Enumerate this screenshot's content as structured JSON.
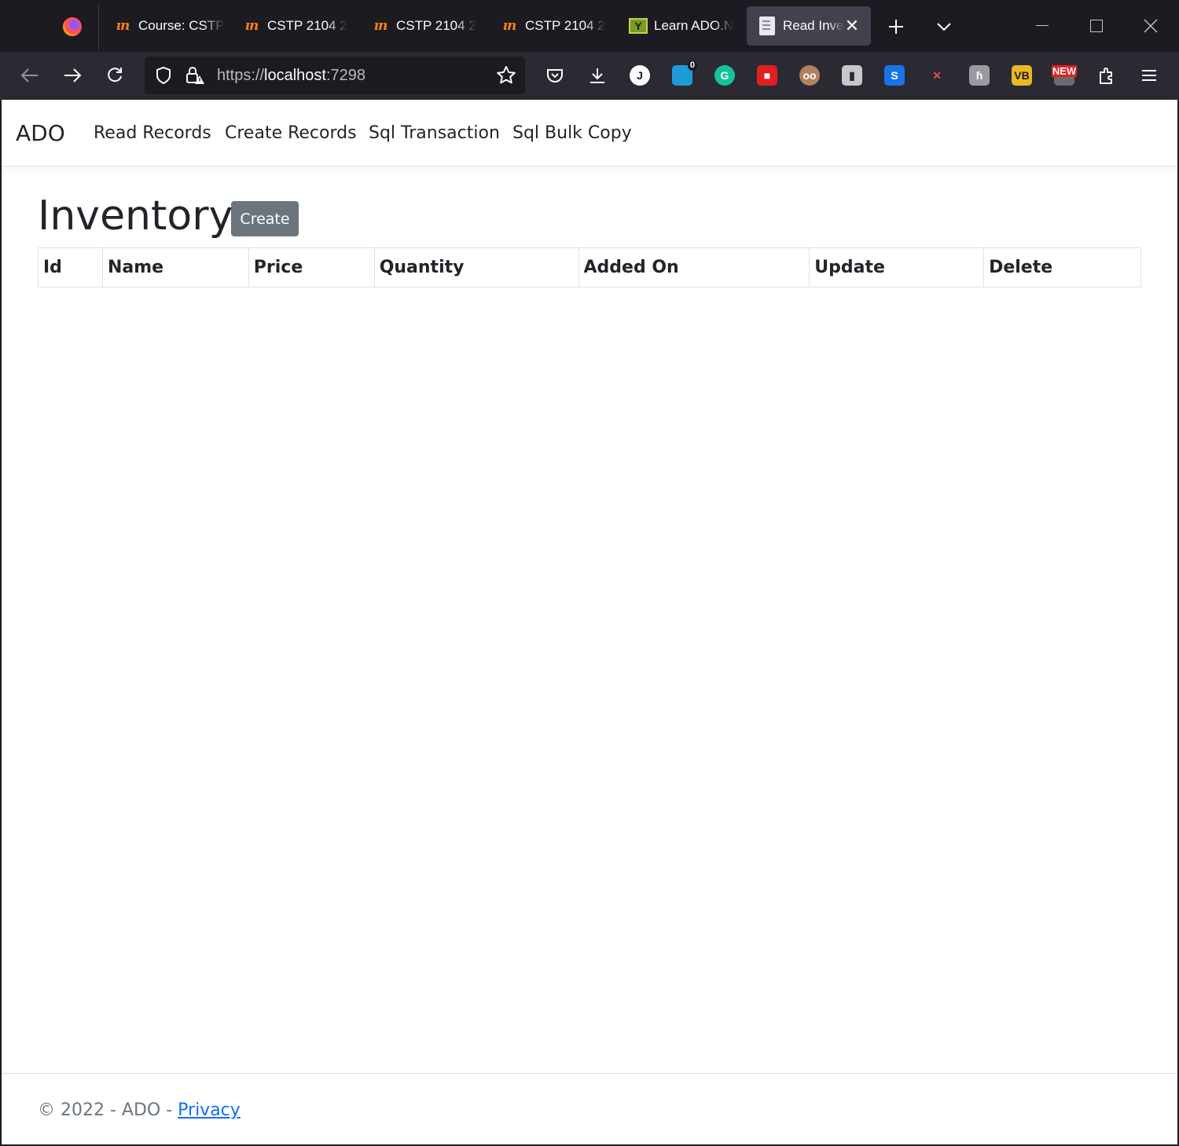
{
  "browser": {
    "tabs": [
      {
        "title": "Course: CSTP",
        "icon": "moodle-icon"
      },
      {
        "title": "CSTP 2104 2",
        "icon": "moodle-icon"
      },
      {
        "title": "CSTP 2104 2",
        "icon": "moodle-icon"
      },
      {
        "title": "CSTP 2104 2",
        "icon": "moodle-icon"
      },
      {
        "title": "Learn ADO.N",
        "icon": "learn-site-icon"
      },
      {
        "title": "Read Inve",
        "icon": "document-icon",
        "active": true
      }
    ],
    "url": {
      "scheme": "https://",
      "host": "localhost",
      "port": ":7298"
    },
    "extension_badge": "0",
    "extension_new_label": "NEW",
    "colors": {
      "tabstrip": "#1c1b22",
      "toolbar": "#2b2a33",
      "active_tab": "#42414d"
    }
  },
  "site": {
    "brand": "ADO",
    "nav": [
      "Read Records",
      "Create Records",
      "Sql Transaction",
      "Sql Bulk Copy"
    ]
  },
  "main": {
    "title": "Inventory",
    "create_label": "Create",
    "table": {
      "headers": [
        "Id",
        "Name",
        "Price",
        "Quantity",
        "Added On",
        "Update",
        "Delete"
      ],
      "rows": []
    }
  },
  "footer": {
    "text": "© 2022 - ADO - ",
    "link": "Privacy"
  },
  "colors": {
    "button_secondary": "#6c757d",
    "link": "#0d6efd",
    "text": "#212529"
  }
}
